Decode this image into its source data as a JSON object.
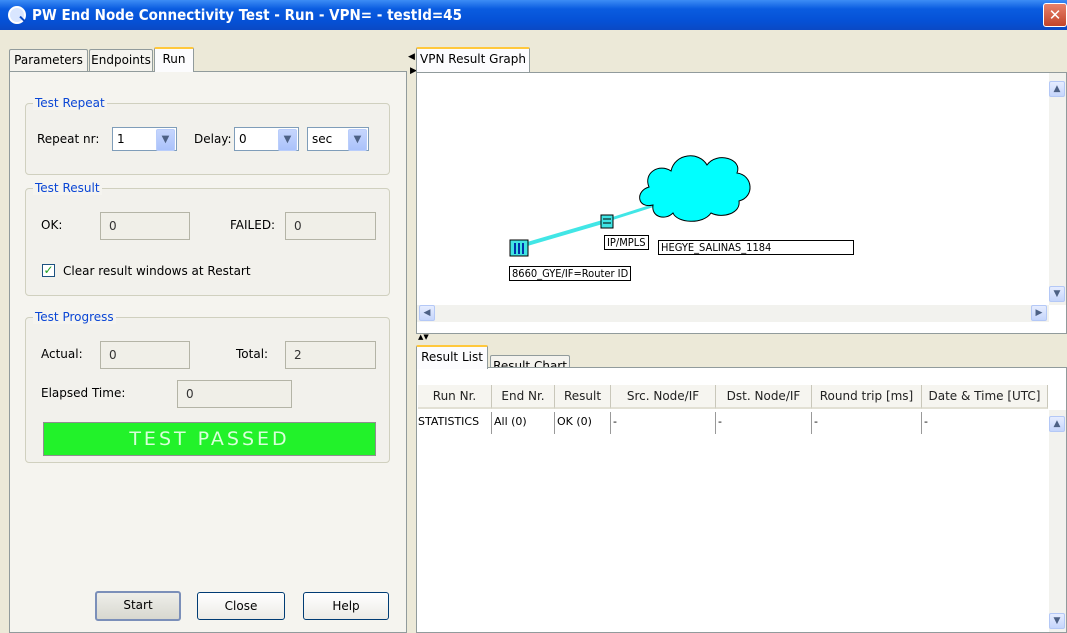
{
  "window": {
    "title": "PW End Node Connectivity Test - Run  - VPN=       - testId=45",
    "close_glyph": "✕"
  },
  "tabs": [
    "Parameters",
    "Endpoints",
    "Run"
  ],
  "test_repeat": {
    "title": "Test Repeat",
    "repeat_label": "Repeat nr:",
    "repeat_value": "1",
    "delay_label": "Delay:",
    "delay_value": "0",
    "unit_value": "sec"
  },
  "test_result": {
    "title": "Test Result",
    "ok_label": "OK:",
    "ok_value": "0",
    "failed_label": "FAILED:",
    "failed_value": "0",
    "clear_label": "Clear result windows at Restart",
    "clear_checked": true
  },
  "test_progress": {
    "title": "Test Progress",
    "actual_label": "Actual:",
    "actual_value": "0",
    "total_label": "Total:",
    "total_value": "2",
    "elapsed_label": "Elapsed Time:",
    "elapsed_value": "0",
    "status": "TEST PASSED",
    "status_color": "#22f22a"
  },
  "buttons": {
    "start": "Start",
    "close": "Close",
    "help": "Help"
  },
  "graph": {
    "tab": "VPN Result Graph",
    "nodes": {
      "router": "8660_GYE/IF=Router ID",
      "ipmpls": "IP/MPLS",
      "cloud": "HEGYE_SALINAS_1184"
    },
    "link_color": "#41e6e6",
    "cloud_color": "#00ffff"
  },
  "results": {
    "tabs": [
      "Result List",
      "Result Chart"
    ],
    "columns": [
      "Run Nr.",
      "End Nr.",
      "Result",
      "Src. Node/IF",
      "Dst. Node/IF",
      "Round trip [ms]",
      "Date & Time [UTC]"
    ],
    "rows": [
      [
        "STATISTICS",
        "All (0)",
        "OK (0)",
        "-",
        "-",
        "-",
        "-"
      ]
    ]
  }
}
